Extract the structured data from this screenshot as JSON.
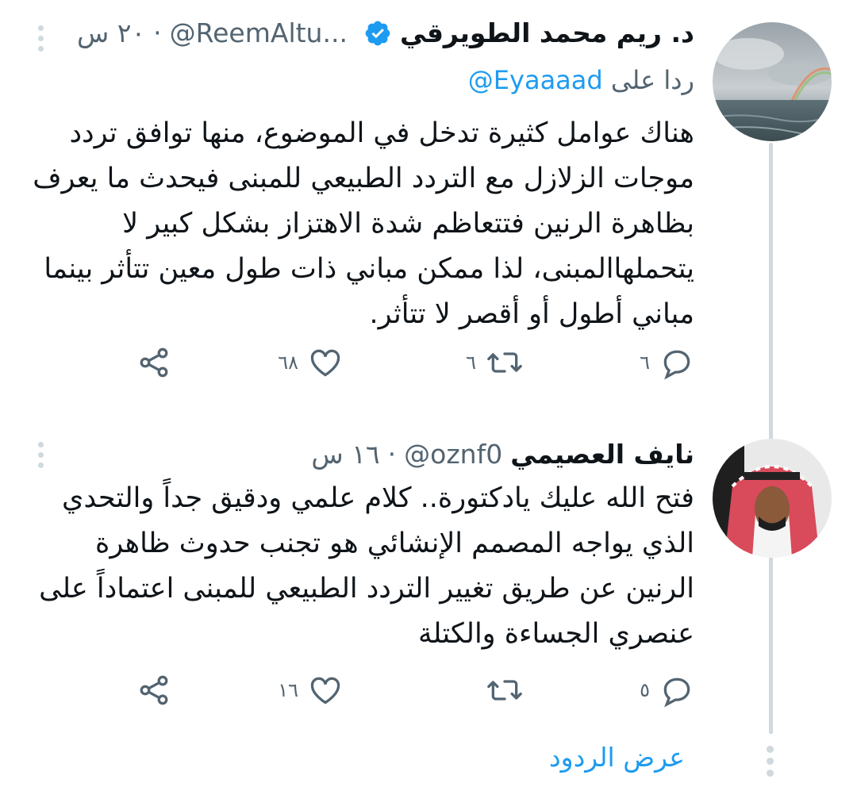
{
  "tweets": [
    {
      "author_name": "د. ريم محمد الطويرقي",
      "handle": "@ReemAltu...",
      "time": "٢٠ س",
      "reply_to_prefix": "ردا على",
      "reply_to_handle": "@Eyaaaad",
      "text": "هناك عوامل كثيرة تدخل في الموضوع، منها توافق تردد موجات الزلازل مع التردد الطبيعي للمبنى فيحدث ما يعرف بظاهرة الرنين فتتعاظم شدة الاهتزاز بشكل كبير لا يتحملهاالمبنى، لذا ممكن مباني ذات طول معين تتأثر بينما مباني أطول أو أقصر لا تتأثر.",
      "reply_count": "٦",
      "retweet_count": "٦",
      "like_count": "٦٨"
    },
    {
      "author_name": "نايف العصيمي",
      "handle": "@oznf0",
      "time": "١٦ س",
      "text": "فتح الله عليك يادكتورة.. كلام علمي ودقيق جداً والتحدي الذي يواجه المصمم الإنشائي هو تجنب حدوث ظاهرة الرنين عن طريق تغيير التردد الطبيعي للمبنى اعتماداً على عنصري الجساءة والكتلة",
      "reply_count": "٥",
      "retweet_count": "",
      "like_count": "١٦"
    }
  ],
  "show_replies_label": "عرض الردود",
  "icons": {
    "verified": "verified-badge-icon",
    "more": "more-options-icon",
    "reply": "reply-bubble-icon",
    "retweet": "retweet-icon",
    "like": "heart-icon",
    "share": "share-icon"
  },
  "colors": {
    "accent": "#1d9bf0",
    "secondary_text": "#536471",
    "thread_line": "#cfd9de"
  }
}
